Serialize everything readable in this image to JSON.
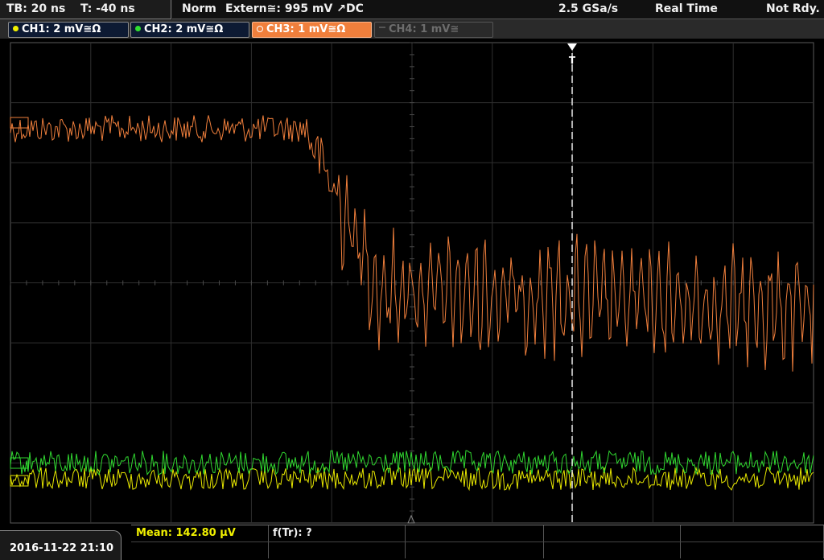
{
  "header": {
    "timebase": "TB: 20 ns",
    "trigger_time": "T: -40 ns",
    "mode": "Norm",
    "trigger_source": "Extern≅: 995 mV ↗DC",
    "sample_rate": "2.5 GSa/s",
    "acquisition": "Real Time",
    "status": "Not Rdy."
  },
  "channels": [
    {
      "label": "CH1: 2 mV≅Ω",
      "color": "#f0f000",
      "state": "on"
    },
    {
      "label": "CH2: 2 mV≅Ω",
      "color": "#30e030",
      "state": "on"
    },
    {
      "label": "CH3: 1 mV≅Ω",
      "color": "#f07f3c",
      "state": "active"
    },
    {
      "label": "CH4: 1 mV≅",
      "color": "#6d6d6d",
      "state": "off"
    }
  ],
  "trigger_marker": "T",
  "footer": {
    "datetime": "2016-11-22 21:10",
    "mean": "Mean: 142.80 µV",
    "ftr": "f(Tr): ?"
  }
}
